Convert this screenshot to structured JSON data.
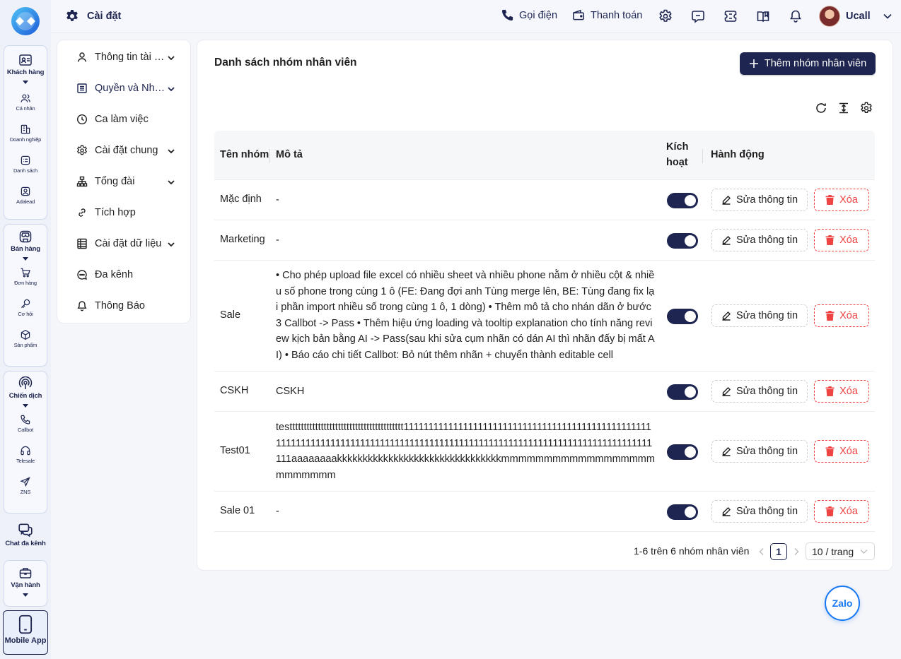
{
  "colors": {
    "primary": "#1d2550",
    "danger": "#ef4444",
    "zalo": "#1877f2"
  },
  "rail": {
    "khach_hang": {
      "label": "Khách hàng",
      "icon": "contact-card-icon",
      "items": [
        {
          "label": "Cá nhân",
          "icon": "users-icon"
        },
        {
          "label": "Doanh nghiệp",
          "icon": "building-icon"
        },
        {
          "label": "Danh sách",
          "icon": "list-icon"
        },
        {
          "label": "Adalead",
          "icon": "user-badge-icon"
        }
      ]
    },
    "ban_hang": {
      "label": "Bán hàng",
      "icon": "store-icon",
      "items": [
        {
          "label": "Đơn hàng",
          "icon": "cart-icon"
        },
        {
          "label": "Cơ hội",
          "icon": "key-icon"
        },
        {
          "label": "Sản phẩm",
          "icon": "box-icon"
        }
      ]
    },
    "chien_dich": {
      "label": "Chiến dịch",
      "icon": "broadcast-icon",
      "items": [
        {
          "label": "Callbot",
          "icon": "phone-icon"
        },
        {
          "label": "Telesale",
          "icon": "headset-icon"
        },
        {
          "label": "ZNS",
          "icon": "send-icon"
        }
      ]
    },
    "chat": {
      "label": "Chat đa kênh",
      "icon": "chat-icon"
    },
    "van_hanh": {
      "label": "Vận hành",
      "icon": "briefcase-icon"
    },
    "mobile": {
      "label": "Mobile App",
      "icon": "mobile-icon"
    }
  },
  "topbar": {
    "title": "Cài đặt",
    "call": "Gọi điện",
    "payment": "Thanh toán",
    "user": "Ucall"
  },
  "menu": [
    {
      "label": "Thông tin tài khoản",
      "icon": "user-icon",
      "has_chevron": true
    },
    {
      "label": "Quyền và Nhân viên",
      "icon": "list-box-icon",
      "has_chevron": true,
      "active": true
    },
    {
      "label": "Ca làm việc",
      "icon": "clock-icon",
      "has_chevron": false
    },
    {
      "label": "Cài đặt chung",
      "icon": "gear-icon",
      "has_chevron": true
    },
    {
      "label": "Tổng đài",
      "icon": "hierarchy-icon",
      "has_chevron": true
    },
    {
      "label": "Tích hợp",
      "icon": "link-icon",
      "has_chevron": false
    },
    {
      "label": "Cài đặt dữ liệu",
      "icon": "table-icon",
      "has_chevron": true
    },
    {
      "label": "Đa kênh",
      "icon": "chat-dots-icon",
      "has_chevron": false
    },
    {
      "label": "Thông Báo",
      "icon": "bell-icon",
      "has_chevron": false
    }
  ],
  "main": {
    "title": "Danh sách nhóm nhân viên",
    "add_button": "Thêm nhóm nhân viên",
    "columns": {
      "name": "Tên nhóm",
      "desc": "Mô tả",
      "active_1": "Kích",
      "active_2": "hoạt",
      "actions": "Hành động"
    },
    "edit_label": "Sửa thông tin",
    "delete_label": "Xóa",
    "rows": [
      {
        "name": "Mặc định",
        "desc": "-",
        "active": true
      },
      {
        "name": "Marketing",
        "desc": "-",
        "active": true
      },
      {
        "name": "Sale",
        "desc": "•   Cho phép upload file excel có nhiều sheet và nhiều phone nằm ở nhiều cột & nhiều số phone trong cùng 1 ô (FE: Đang đợi anh Tùng merge lên, BE: Tùng đang fix lại phần import nhiều số trong cùng 1 ô, 1 dòng) •     Thêm mô tả cho nhán dãn ở bước 3 Callbot -> Pass • Thêm hiệu ứng loading và tooltip explanation cho tính năng review kịch bản bằng AI  -> Pass(sau khi sửa cụm nhãn có dán AI thì nhãn đấy bị mất AI) •    Báo cáo chi tiết Callbot: Bỏ nút thêm nhãn + chuyển thành editable cell",
        "active": true
      },
      {
        "name": "CSKH",
        "desc": "CSKH",
        "active": true
      },
      {
        "name": "Test01",
        "desc": "testttttttttttttttttttttttttttttttttttttttt111111111111111111111111111111111111111111111111111111111111111111111111111111111111111111111111111111111111111111111111111111111aaaaaaaakkkkkkkkkkkkkkkkkkkkkkkkkkkkkkkkmmmmmmmmmmmmmmmmmmmmmmmmm",
        "active": true
      },
      {
        "name": "Sale 01",
        "desc": "-",
        "active": true
      }
    ],
    "pagination": {
      "summary": "1-6 trên 6 nhóm nhân viên",
      "current_page": "1",
      "page_size": "10 / trang"
    }
  },
  "zalo": "Zalo"
}
